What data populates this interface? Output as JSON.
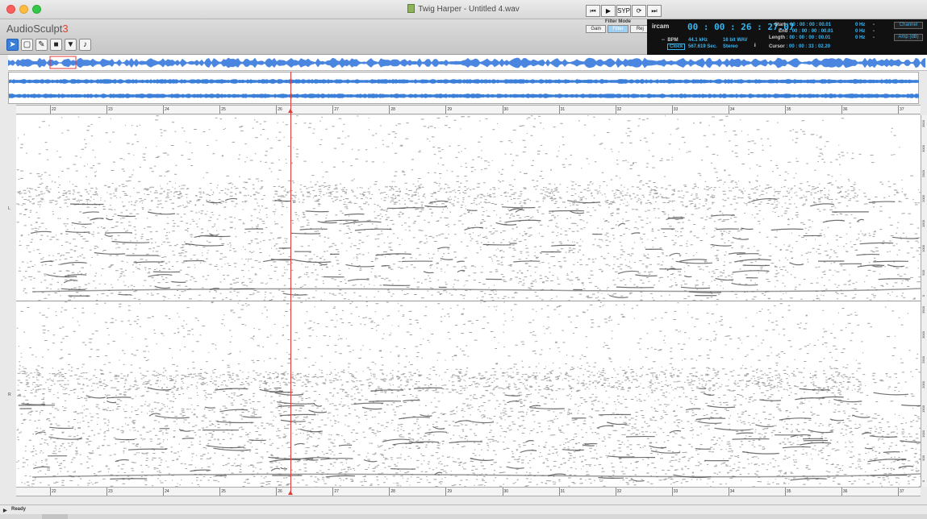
{
  "window": {
    "title": "Twig Harper - Untitled 4.wav"
  },
  "app": {
    "name_prefix": "AudioSculpt",
    "version": "3"
  },
  "colors": {
    "accent": "#39b6f0",
    "cursor": "#e03a3a",
    "waveform": "#3b7fd9",
    "brand_version": "#e2412c"
  },
  "tools": [
    {
      "name": "pointer",
      "glyph": "➤"
    },
    {
      "name": "box-select",
      "glyph": "▢"
    },
    {
      "name": "pencil",
      "glyph": "✎"
    },
    {
      "name": "color-tool",
      "glyph": "■"
    },
    {
      "name": "filter",
      "glyph": "▼"
    },
    {
      "name": "note",
      "glyph": "♪"
    }
  ],
  "transport": {
    "buttons": [
      "⏮",
      "▶",
      "SYP",
      "⟳",
      "⏭"
    ]
  },
  "filter_mode": {
    "label": "Filter Mode",
    "buttons": [
      "Gain",
      "Filter",
      "Rej"
    ]
  },
  "info": {
    "logo": "ircam",
    "timecode": "00 : 00 : 26 : 27.07",
    "start_label": "Start",
    "start": "00 : 00 : 00 : 00.01",
    "end_label": "End",
    "end": "00 : 00 : 00 : 00.01",
    "length_label": "Length",
    "length": "00 : 00 : 00 : 00.01",
    "cursor_label": "Cursor",
    "cursor": "00 : 00 : 33 : 02.20",
    "bpm_prefix": "--",
    "bpm_label": "BPM",
    "sample_rate": "44.1 kHz",
    "bit_depth": "16 bit WAV",
    "duration": "567.619 Sec.",
    "channels": "Stereo",
    "hz1": "0 Hz",
    "hz2": "0 Hz",
    "hz3": "0 Hz",
    "dash": "-",
    "channel_btn": "Channel",
    "amp_btn": "Amp (dB)",
    "clock_btn": "Clock",
    "info_glyph": "i"
  },
  "ruler": {
    "ticks": [
      "22",
      "23",
      "24",
      "25",
      "26",
      "27",
      "28",
      "29",
      "30",
      "31",
      "32",
      "33",
      "34",
      "35",
      "36",
      "37"
    ]
  },
  "channels": {
    "left": "L",
    "right": "R"
  },
  "freq_axis": {
    "ticks": [
      "3500",
      "3000",
      "2500",
      "2000",
      "1500",
      "1000",
      "500",
      "0"
    ]
  },
  "status": {
    "text": "Ready"
  }
}
